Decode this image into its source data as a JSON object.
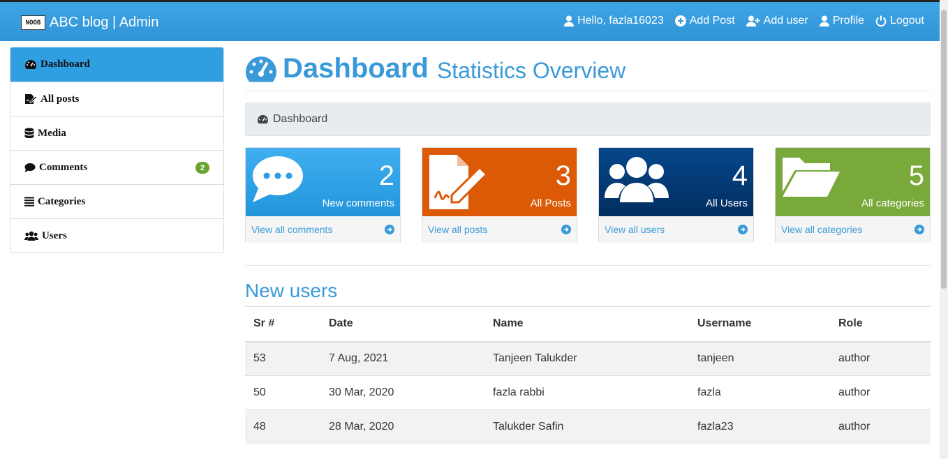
{
  "navbar": {
    "logo_text": "NOOB",
    "brand": "ABC blog | Admin",
    "links": [
      {
        "label": "Hello, fazla16023",
        "icon": "user-icon"
      },
      {
        "label": "Add Post",
        "icon": "plus-circle-icon"
      },
      {
        "label": "Add user",
        "icon": "user-plus-icon"
      },
      {
        "label": "Profile",
        "icon": "user-icon"
      },
      {
        "label": "Logout",
        "icon": "power-icon"
      }
    ]
  },
  "sidebar": {
    "items": [
      {
        "label": "Dashboard",
        "icon": "tachometer-icon",
        "active": true
      },
      {
        "label": "All posts",
        "icon": "edit-icon"
      },
      {
        "label": "Media",
        "icon": "database-icon"
      },
      {
        "label": "Comments",
        "icon": "comment-icon",
        "badge": "2"
      },
      {
        "label": "Categories",
        "icon": "list-icon"
      },
      {
        "label": "Users",
        "icon": "users-icon"
      }
    ]
  },
  "header": {
    "title": "Dashboard",
    "subtitle": "Statistics Overview",
    "breadcrumb": "Dashboard"
  },
  "cards": [
    {
      "count": "2",
      "label": "New comments",
      "link": "View all comments",
      "color": "#2a9ee2",
      "icon": "comment-dots-icon"
    },
    {
      "count": "3",
      "label": "All Posts",
      "link": "View all posts",
      "color": "#dc5a06",
      "icon": "file-signature-icon"
    },
    {
      "count": "4",
      "label": "All Users",
      "link": "View all users",
      "color": "#033b77",
      "icon": "users-icon"
    },
    {
      "count": "5",
      "label": "All categories",
      "link": "View all categories",
      "color": "#78a93a",
      "icon": "folder-open-icon"
    }
  ],
  "users_section": {
    "title": "New users",
    "columns": [
      "Sr #",
      "Date",
      "Name",
      "Username",
      "Role"
    ],
    "rows": [
      [
        "53",
        "7 Aug, 2021",
        "Tanjeen Talukder",
        "tanjeen",
        "author"
      ],
      [
        "50",
        "30 Mar, 2020",
        "fazla rabbi",
        "fazla",
        "author"
      ],
      [
        "48",
        "28 Mar, 2020",
        "Talukder Safin",
        "fazla23",
        "author"
      ]
    ]
  },
  "colors": {
    "accent": "#3a9ad9",
    "navbar": "#3fa6e6"
  }
}
